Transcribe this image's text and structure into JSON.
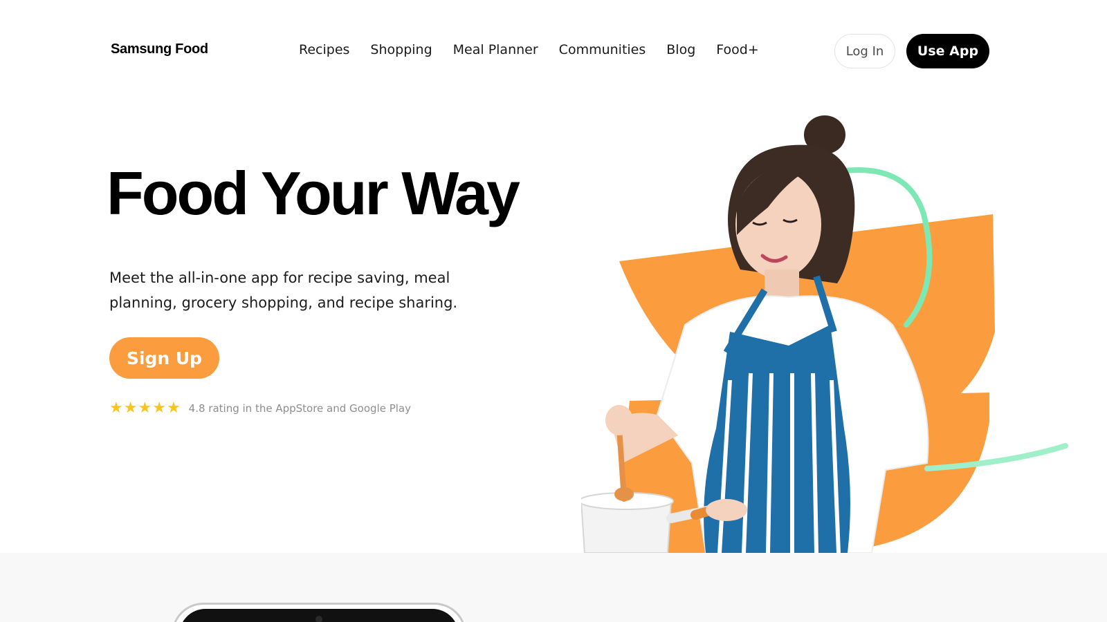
{
  "header": {
    "logo": "Samsung Food",
    "nav": [
      "Recipes",
      "Shopping",
      "Meal Planner",
      "Communities",
      "Blog",
      "Food+"
    ],
    "login_label": "Log In",
    "use_app_label": "Use App"
  },
  "hero": {
    "title": "Food Your Way",
    "subtitle": "Meet the all-in-one app for recipe saving, meal planning, grocery shopping, and recipe sharing.",
    "signup_label": "Sign Up",
    "rating_stars": 5,
    "rating_text": "4.8 rating in the AppStore and Google Play"
  },
  "colors": {
    "accent_orange": "#fb9d3e",
    "star_yellow": "#f8c51d",
    "mint": "#7ee8b4",
    "apron_blue": "#1f6fa8"
  },
  "icons": [
    "star-icon"
  ]
}
